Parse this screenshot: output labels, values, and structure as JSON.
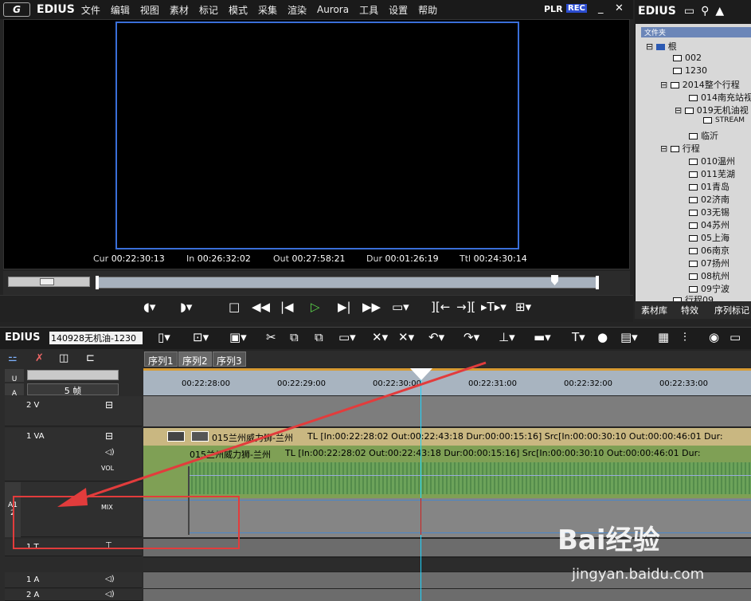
{
  "menubar": {
    "logo": "G",
    "brand": "EDIUS",
    "items": [
      "文件",
      "编辑",
      "视图",
      "素材",
      "标记",
      "模式",
      "采集",
      "渲染",
      "Aurora",
      "工具",
      "设置",
      "帮助"
    ],
    "plr": "PLR",
    "rec": "REC",
    "minimize": "_",
    "close": "✕"
  },
  "timecodes": {
    "cur_label": "Cur",
    "cur": "00:22:30:13",
    "in_label": "In",
    "in": "00:26:32:02",
    "out_label": "Out",
    "out": "00:27:58:21",
    "dur_label": "Dur",
    "dur": "00:01:26:19",
    "ttl_label": "Ttl",
    "ttl": "00:24:30:14"
  },
  "bin": {
    "title": "EDIUS",
    "folder_header": "文件夹",
    "tree": [
      "根",
      "002",
      "1230",
      "2014整个行程",
      "014南充站视",
      "019无机油视",
      "STREAM",
      "临沂",
      "行程",
      "010温州",
      "011芜湖",
      "01青岛",
      "02济南",
      "03无锡",
      "04苏州",
      "05上海",
      "06南京",
      "07扬州",
      "08杭州",
      "09宁波",
      "行程09"
    ],
    "tabs": [
      "素材库",
      "特效",
      "序列标记"
    ]
  },
  "timeline": {
    "brand": "EDIUS",
    "project_name": "140928无机油-1230",
    "seq_tabs": [
      "序列1",
      "序列2",
      "序列3"
    ],
    "scale": "5 帧",
    "ruler": [
      "00:22:28:00",
      "00:22:29:00",
      "00:22:30:00",
      "00:22:31:00",
      "00:22:32:00",
      "00:22:33:00"
    ]
  },
  "tracks": {
    "v2": "2 V",
    "va1": "1 VA",
    "vol": "VOL",
    "mix": "MIX",
    "a12": "A1 2",
    "t1": "1 T",
    "a1": "1 A",
    "a2": "2 A",
    "u": "U",
    "a": "A"
  },
  "clips": {
    "video_title": "015兰州威力狮-兰州",
    "video_info": "TL [In:00:22:28:02 Out:00:22:43:18 Dur:00:00:15:16]  Src[In:00:00:30:10 Out:00:00:46:01 Dur:",
    "audio_title": "015兰州威力狮-兰州",
    "audio_info": "TL [In:00:22:28:02 Out:00:22:43:18 Dur:00:00:15:16]  Src[In:00:00:30:10 Out:00:00:46:01 Dur:"
  },
  "watermark": {
    "text": "Bai经验",
    "url": "jingyan.baidu.com"
  }
}
